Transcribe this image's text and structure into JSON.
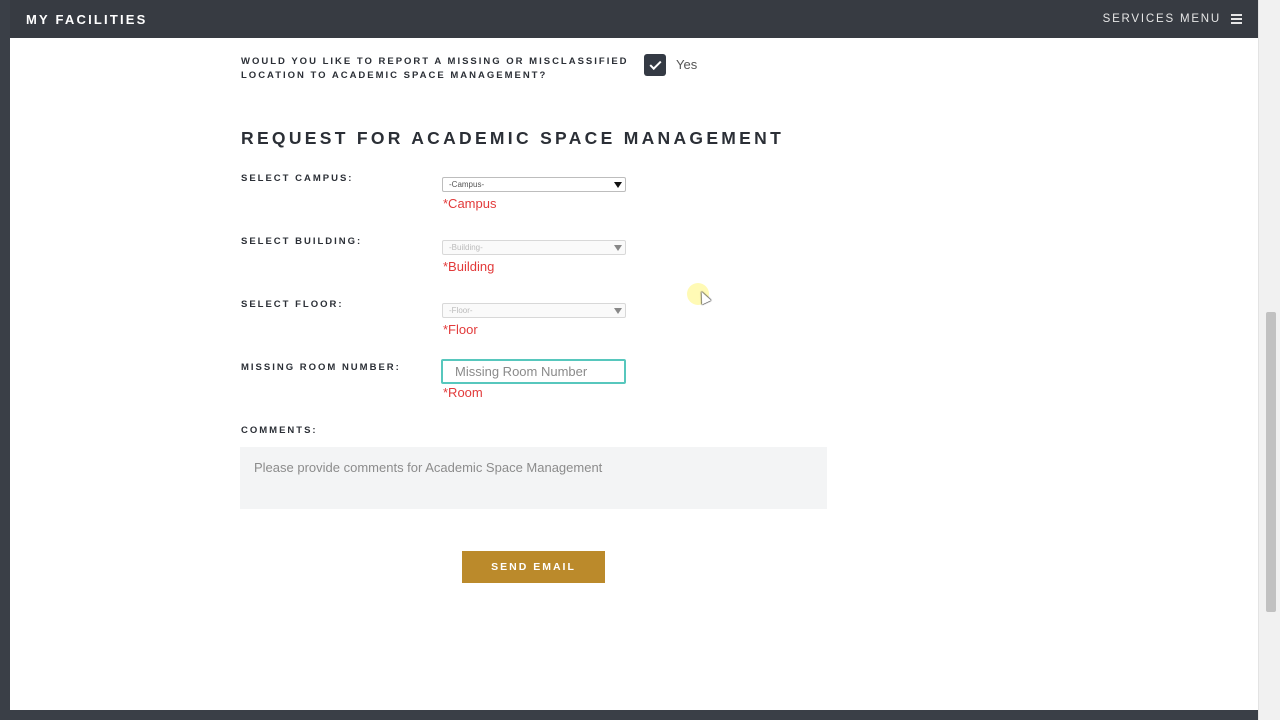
{
  "header": {
    "brand": "MY FACILITIES",
    "services_label": "SERVICES MENU",
    "menu_icon": "hamburger-icon"
  },
  "report_question": {
    "label": "WOULD YOU LIKE TO REPORT A MISSING OR MISCLASSIFIED LOCATION TO ACADEMIC SPACE MANAGEMENT?",
    "checked": true,
    "answer_label": "Yes"
  },
  "section_title": "REQUEST FOR ACADEMIC SPACE MANAGEMENT",
  "form": {
    "campus": {
      "label": "SELECT CAMPUS:",
      "selected": "-Campus-",
      "required_text": "*Campus"
    },
    "building": {
      "label": "SELECT BUILDING:",
      "selected": "-Building-",
      "required_text": "*Building"
    },
    "floor": {
      "label": "SELECT FLOOR:",
      "selected": "-Floor-",
      "required_text": "*Floor"
    },
    "room": {
      "label": "MISSING ROOM NUMBER:",
      "placeholder": "Missing Room Number",
      "value": "",
      "required_text": "*Room"
    },
    "comments": {
      "label": "COMMENTS:",
      "placeholder": "Please provide comments for Academic Space Management",
      "value": ""
    },
    "submit_label": "SEND EMAIL"
  },
  "colors": {
    "header_bg": "#373b42",
    "accent_gold": "#bb8a2b",
    "required_red": "#e23a3a",
    "focus_teal": "#57c7bd"
  }
}
